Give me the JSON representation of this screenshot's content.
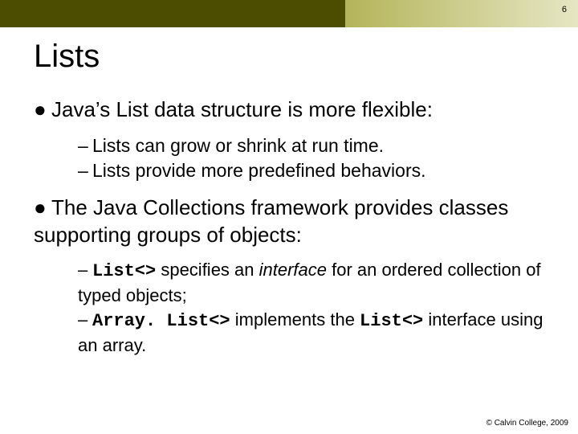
{
  "page_number": "6",
  "title": "Lists",
  "bullets": {
    "b1": {
      "text": "Java’s List data structure is more flexible:",
      "sub1": "Lists can grow or shrink at run time.",
      "sub2": "Lists provide more predefined behaviors."
    },
    "b2": {
      "text": "The Java Collections framework provides classes supporting groups of objects:",
      "sub1_code": "List<>",
      "sub1_mid": " specifies an ",
      "sub1_italic": "interface",
      "sub1_rest": " for an ordered collection of typed objects;",
      "sub2_code1": "Array. List<>",
      "sub2_mid": " implements the ",
      "sub2_code2": "List<>",
      "sub2_rest": " interface using an array."
    }
  },
  "footer": "© Calvin College, 2009"
}
